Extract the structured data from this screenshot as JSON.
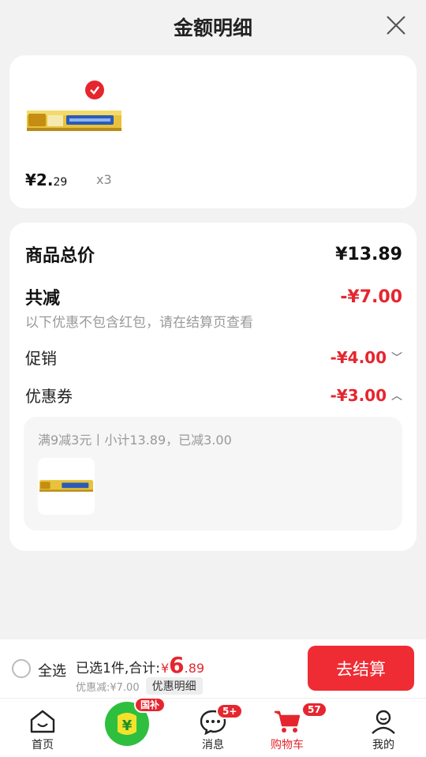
{
  "header": {
    "title": "金额明细"
  },
  "item": {
    "price_int": "¥2.",
    "price_dec": "29",
    "qty": "x3"
  },
  "summary": {
    "total_label": "商品总价",
    "total_value": "¥13.89",
    "reduce_label": "共减",
    "reduce_value": "-¥7.00",
    "note": "以下优惠不包含红包，请在结算页查看",
    "promo_label": "促销",
    "promo_value": "-¥4.00",
    "coupon_label": "优惠券",
    "coupon_value": "-¥3.00",
    "coupon_detail": "满9减3元丨小计13.89，已减3.00"
  },
  "bottom": {
    "select_all": "全选",
    "selected_text": "已选1件,合计:",
    "currency": "¥",
    "total_int": "6",
    "total_dec": ".89",
    "discount_text": "优惠减:¥7.00",
    "detail_btn": "优惠明细",
    "checkout": "去结算"
  },
  "tabs": [
    {
      "label": "首页",
      "icon": "home-icon"
    },
    {
      "label": "",
      "icon": "subsidy-icon",
      "badge": "国补"
    },
    {
      "label": "消息",
      "icon": "message-icon",
      "badge": "5+"
    },
    {
      "label": "购物车",
      "icon": "cart-icon",
      "badge": "57"
    },
    {
      "label": "我的",
      "icon": "profile-icon"
    }
  ],
  "colors": {
    "accent": "#e5262f",
    "checkout": "#ef2c34",
    "subsidy": "#2fbf3f"
  }
}
